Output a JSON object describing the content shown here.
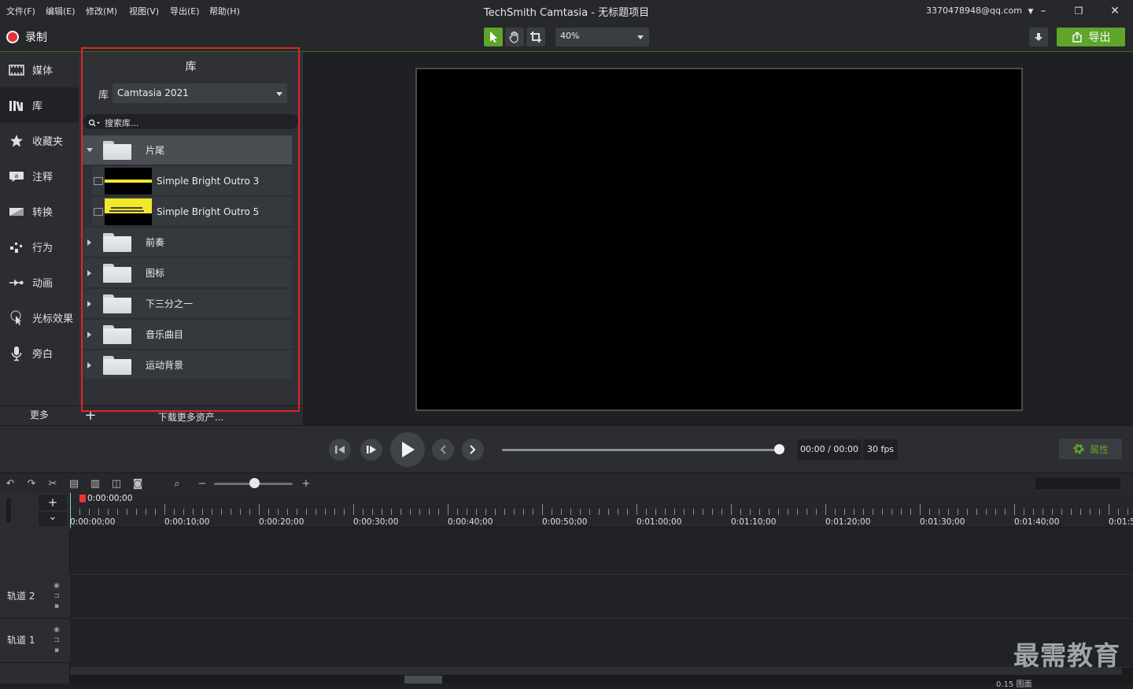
{
  "menu": [
    "文件(F)",
    "编辑(E)",
    "修改(M)",
    "视图(V)",
    "导出(E)",
    "帮助(H)"
  ],
  "window": {
    "title": "TechSmith Camtasia - 无标题项目",
    "account": "3370478948@qq.com",
    "minimize": "–",
    "restore": "❐",
    "close": "✕"
  },
  "toolbar": {
    "record_label": "录制",
    "zoom": "40%",
    "export_label": "导出"
  },
  "nav": [
    {
      "label": "媒体",
      "icon": "media-icon"
    },
    {
      "label": "库",
      "icon": "library-icon"
    },
    {
      "label": "收藏夹",
      "icon": "favorites-icon"
    },
    {
      "label": "注释",
      "icon": "annotations-icon"
    },
    {
      "label": "转换",
      "icon": "transitions-icon"
    },
    {
      "label": "行为",
      "icon": "behaviors-icon"
    },
    {
      "label": "动画",
      "icon": "animations-icon"
    },
    {
      "label": "光标效果",
      "icon": "cursor-effects-icon"
    },
    {
      "label": "旁白",
      "icon": "voice-narration-icon"
    }
  ],
  "nav_more": "更多",
  "library": {
    "title": "库",
    "select_label": "库",
    "selected_library": "Camtasia 2021",
    "search_placeholder": "搜索库...",
    "items": [
      {
        "type": "folder",
        "name": "片尾",
        "expanded": true
      },
      {
        "type": "asset",
        "name": "Simple Bright Outro 3"
      },
      {
        "type": "asset",
        "name": "Simple Bright Outro 5"
      },
      {
        "type": "folder",
        "name": "前奏"
      },
      {
        "type": "folder",
        "name": "图标"
      },
      {
        "type": "folder",
        "name": "下三分之一"
      },
      {
        "type": "folder",
        "name": "音乐曲目"
      },
      {
        "type": "folder",
        "name": "运动背景"
      }
    ],
    "add_label": "+",
    "download_more": "下载更多资产..."
  },
  "playback": {
    "time": "00:00 / 00:00",
    "fps": "30 fps",
    "properties_label": "属性",
    "progress": 1.0
  },
  "timeline": {
    "playhead": "0:00:00;00",
    "ticks": [
      "0:00:00;00",
      "0:00:10;00",
      "0:00:20;00",
      "0:00:30;00",
      "0:00:40;00",
      "0:00:50;00",
      "0:01:00;00",
      "0:01:10;00",
      "0:01:20;00",
      "0:01:30;00",
      "0:01:40;00",
      "0:01:5"
    ],
    "tracks": [
      "轨道 2",
      "轨道 1"
    ],
    "add_track": "+",
    "collapse": "⌄"
  },
  "watermark": "最需教育",
  "footer_zoom": "0.15 图面"
}
